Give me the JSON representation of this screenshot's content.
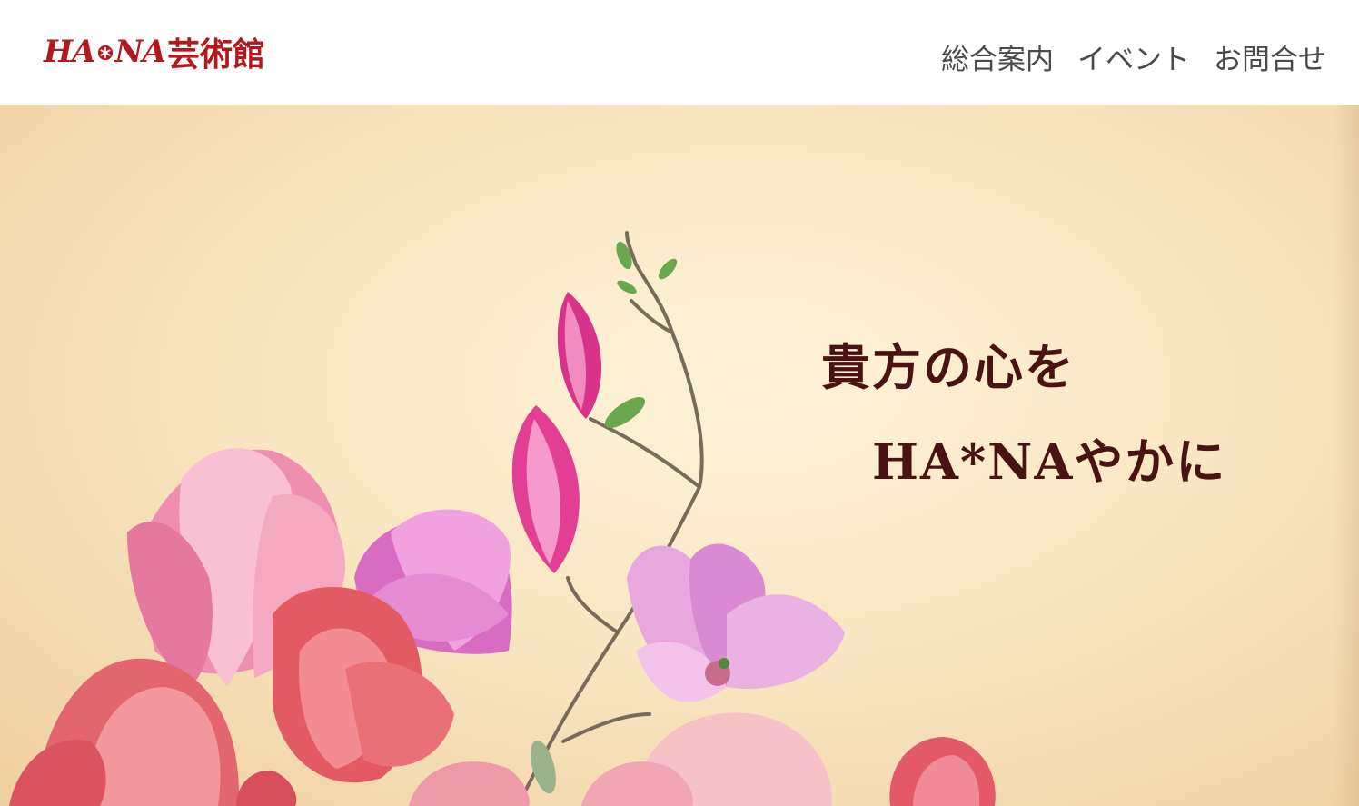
{
  "header": {
    "logo": {
      "mark_text": "HA*NA",
      "jp_text": "芸術館"
    },
    "nav": [
      {
        "label": "総合案内"
      },
      {
        "label": "イベント"
      },
      {
        "label": "お問合せ"
      }
    ]
  },
  "hero": {
    "line1": "貴方の心を",
    "line2": "HA*NAやかに"
  },
  "colors": {
    "brand": "#b3191c",
    "nav_text": "#4a4a4a",
    "hero_text": "#4a1212",
    "hero_bg": "#f9e6c2"
  }
}
